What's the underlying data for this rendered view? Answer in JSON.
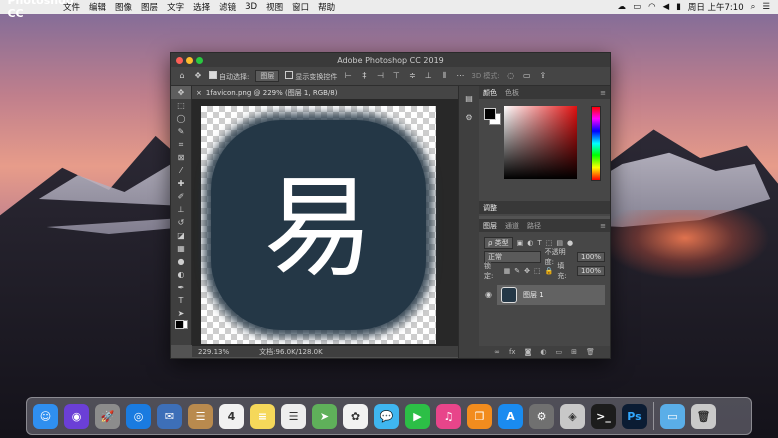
{
  "menubar": {
    "app_name": "Photoshop CC",
    "items": [
      "文件",
      "编辑",
      "图像",
      "图层",
      "文字",
      "选择",
      "滤镜",
      "3D",
      "视图",
      "窗口",
      "帮助"
    ],
    "clock": "周日 上午7:10"
  },
  "window": {
    "title": "Adobe Photoshop CC 2019",
    "doc_tab": "1favicon.png @ 229% (图层 1, RGB/8)",
    "status_zoom": "229.13%",
    "status_doc": "文档:96.0K/128.0K"
  },
  "options": {
    "auto_select_label": "自动选择:",
    "auto_select_value": "图层",
    "show_transform_label": "显示变换控件",
    "mode_3d": "3D 模式:"
  },
  "canvas": {
    "glyph": "易",
    "icon_color": "#243746"
  },
  "panels": {
    "color_tabs": [
      "颜色",
      "色板"
    ],
    "adjust_tab": "调整",
    "layer_tabs": [
      "图层",
      "通道",
      "路径"
    ],
    "kind_label": "ρ 类型",
    "blend_mode": "正常",
    "opacity_label": "不透明度:",
    "opacity_value": "100%",
    "lock_label": "锁定:",
    "fill_label": "填充:",
    "fill_value": "100%",
    "layer_name": "图层 1"
  },
  "dock_apps": [
    {
      "name": "finder",
      "glyph": "☺",
      "color": "#2f8ff0"
    },
    {
      "name": "siri",
      "glyph": "◉",
      "color": "#6b3fd6"
    },
    {
      "name": "launchpad",
      "glyph": "🚀",
      "color": "#8c8c8c"
    },
    {
      "name": "safari",
      "glyph": "◎",
      "color": "#1a7be0"
    },
    {
      "name": "mail",
      "glyph": "✉",
      "color": "#3d6fb8"
    },
    {
      "name": "contacts",
      "glyph": "☰",
      "color": "#b98a4e"
    },
    {
      "name": "calendar",
      "glyph": "4",
      "color": "#f1f1f1"
    },
    {
      "name": "notes",
      "glyph": "≡",
      "color": "#f5d85a"
    },
    {
      "name": "reminders",
      "glyph": "☰",
      "color": "#eeeeee"
    },
    {
      "name": "maps",
      "glyph": "➤",
      "color": "#5fb05a"
    },
    {
      "name": "photos",
      "glyph": "✿",
      "color": "#f2f2f2"
    },
    {
      "name": "messages",
      "glyph": "💬",
      "color": "#3fb6f0"
    },
    {
      "name": "facetime",
      "glyph": "▶",
      "color": "#2cbf46"
    },
    {
      "name": "itunes",
      "glyph": "♫",
      "color": "#e8458a"
    },
    {
      "name": "ibooks",
      "glyph": "❐",
      "color": "#f28c1e"
    },
    {
      "name": "app-store",
      "glyph": "A",
      "color": "#1a8bf0"
    },
    {
      "name": "system-preferences",
      "glyph": "⚙",
      "color": "#707070"
    },
    {
      "name": "parallels",
      "glyph": "◈",
      "color": "#c8c8c8"
    },
    {
      "name": "terminal",
      "glyph": ">_",
      "color": "#1c1c1c"
    },
    {
      "name": "photoshop",
      "glyph": "Ps",
      "color": "#0b1c33"
    },
    {
      "name": "downloads-folder",
      "glyph": "▭",
      "color": "#5aaee8"
    },
    {
      "name": "trash",
      "glyph": "🗑",
      "color": "#c9c9c9"
    }
  ]
}
